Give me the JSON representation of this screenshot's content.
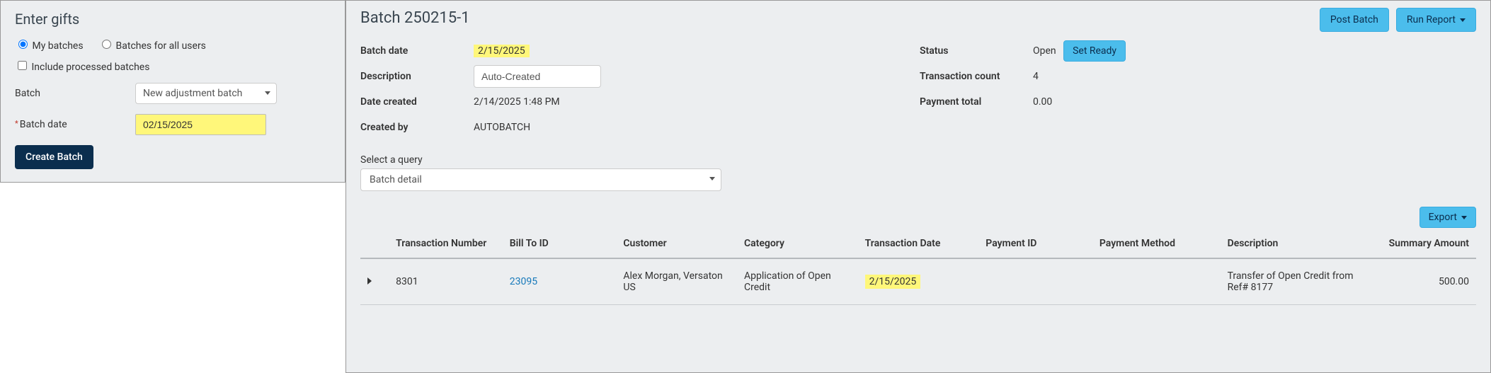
{
  "left": {
    "title": "Enter gifts",
    "radio_my": "My batches",
    "radio_all": "Batches for all users",
    "chk_include": "Include processed batches",
    "batch_label": "Batch",
    "batch_select": "New adjustment batch",
    "batchdate_label": "Batch date",
    "batchdate_value": "02/15/2025",
    "create_btn": "Create Batch"
  },
  "right": {
    "title": "Batch 250215-1",
    "post_btn": "Post Batch",
    "run_btn": "Run Report ",
    "details_a": {
      "batch_date_l": "Batch date",
      "batch_date_v": "2/15/2025",
      "desc_l": "Description",
      "desc_v": "Auto-Created",
      "date_created_l": "Date created",
      "date_created_v": "2/14/2025 1:48 PM",
      "created_by_l": "Created by",
      "created_by_v": "AUTOBATCH"
    },
    "details_b": {
      "status_l": "Status",
      "status_v": "Open",
      "set_ready": "Set Ready",
      "txn_count_l": "Transaction count",
      "txn_count_v": "4",
      "pay_total_l": "Payment total",
      "pay_total_v": "0.00"
    },
    "query_l": "Select a query",
    "query_v": "Batch detail",
    "export_btn": "Export ",
    "cols": {
      "c0": "",
      "c1": "Transaction Number",
      "c2": "Bill To ID",
      "c3": "Customer",
      "c4": "Category",
      "c5": "Transaction Date",
      "c6": "Payment ID",
      "c7": "Payment Method",
      "c8": "Description",
      "c9": "Summary Amount"
    },
    "row": {
      "txn_num": "8301",
      "bill_to": "23095",
      "customer": "Alex Morgan, Versaton US",
      "category": "Application of Open Credit",
      "txn_date": "2/15/2025",
      "payment_id": "",
      "payment_method": "",
      "desc": "Transfer of Open Credit from Ref# 8177",
      "amount": "500.00"
    }
  }
}
